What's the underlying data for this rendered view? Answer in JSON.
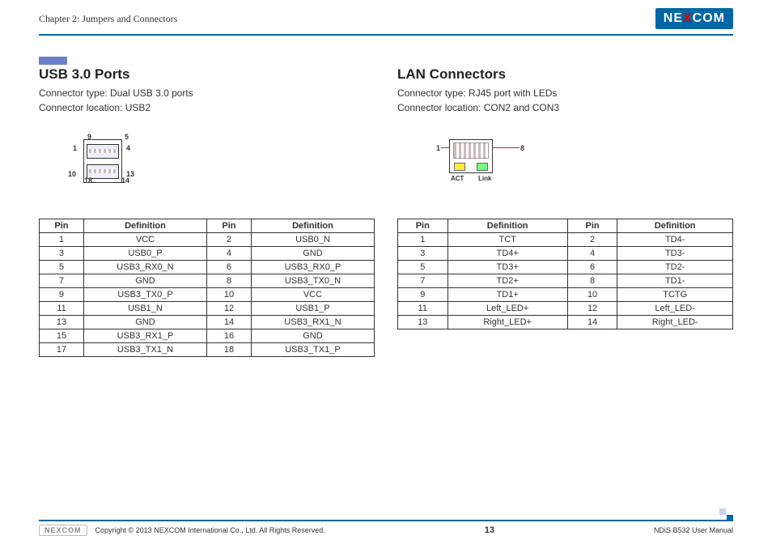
{
  "header": {
    "chapter": "Chapter 2: Jumpers and Connectors",
    "brand": "NEXCOM"
  },
  "footer": {
    "copyright": "Copyright © 2013 NEXCOM International Co., Ltd. All Rights Reserved.",
    "page": "13",
    "manual": "NDiS B532 User Manual"
  },
  "usb": {
    "title": "USB 3.0 Ports",
    "type": "Connector type: Dual USB 3.0 ports",
    "loc": "Connector location: USB2",
    "pins": {
      "p1": "1",
      "p4": "4",
      "p5": "5",
      "p9": "9",
      "p10": "10",
      "p13": "13",
      "p14": "14",
      "p18": "18"
    },
    "th": [
      "Pin",
      "Definition",
      "Pin",
      "Definition"
    ],
    "rows": [
      [
        "1",
        "VCC",
        "2",
        "USB0_N"
      ],
      [
        "3",
        "USB0_P",
        "4",
        "GND"
      ],
      [
        "5",
        "USB3_RX0_N",
        "6",
        "USB3_RX0_P"
      ],
      [
        "7",
        "GND",
        "8",
        "USB3_TX0_N"
      ],
      [
        "9",
        "USB3_TX0_P",
        "10",
        "VCC"
      ],
      [
        "11",
        "USB1_N",
        "12",
        "USB1_P"
      ],
      [
        "13",
        "GND",
        "14",
        "USB3_RX1_N"
      ],
      [
        "15",
        "USB3_RX1_P",
        "16",
        "GND"
      ],
      [
        "17",
        "USB3_TX1_N",
        "18",
        "USB3_TX1_P"
      ]
    ]
  },
  "lan": {
    "title": "LAN Connectors",
    "type": "Connector type: RJ45 port with LEDs",
    "loc": "Connector location: CON2 and CON3",
    "pins": {
      "p1": "1",
      "p8": "8"
    },
    "led": {
      "act": "ACT",
      "link": "Link"
    },
    "th": [
      "Pin",
      "Definition",
      "Pin",
      "Definition"
    ],
    "rows": [
      [
        "1",
        "TCT",
        "2",
        "TD4-"
      ],
      [
        "3",
        "TD4+",
        "4",
        "TD3-"
      ],
      [
        "5",
        "TD3+",
        "6",
        "TD2-"
      ],
      [
        "7",
        "TD2+",
        "8",
        "TD1-"
      ],
      [
        "9",
        "TD1+",
        "10",
        "TCTG"
      ],
      [
        "11",
        "Left_LED+",
        "12",
        "Left_LED-"
      ],
      [
        "13",
        "Right_LED+",
        "14",
        "Right_LED-"
      ]
    ]
  }
}
